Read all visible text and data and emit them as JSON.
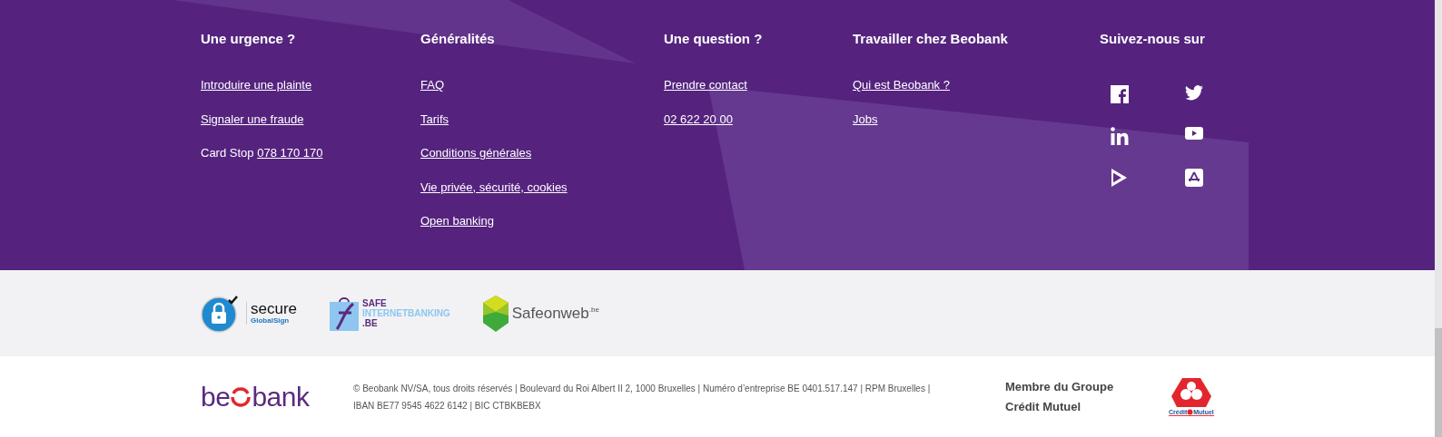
{
  "footer_columns": [
    {
      "heading": "Une urgence ?",
      "links": [
        {
          "kind": "link",
          "text": "Introduire une plainte"
        },
        {
          "kind": "link",
          "text": "Signaler une fraude"
        },
        {
          "kind": "labelled",
          "label": "Card Stop",
          "text": "078 170 170"
        }
      ]
    },
    {
      "heading": "Généralités",
      "links": [
        {
          "kind": "link",
          "text": "FAQ"
        },
        {
          "kind": "link",
          "text": "Tarifs"
        },
        {
          "kind": "link",
          "text": "Conditions générales"
        },
        {
          "kind": "link",
          "text": "Vie privée, sécurité, cookies"
        },
        {
          "kind": "link",
          "text": "Open banking"
        }
      ]
    },
    {
      "heading": "Une question ?",
      "links": [
        {
          "kind": "link",
          "text": "Prendre contact"
        },
        {
          "kind": "link",
          "text": "02 622 20 00"
        }
      ]
    },
    {
      "heading": "Travailler chez Beobank",
      "links": [
        {
          "kind": "link",
          "text": "Qui est Beobank ?"
        },
        {
          "kind": "link",
          "text": "Jobs"
        }
      ]
    }
  ],
  "social": {
    "heading": "Suivez-nous sur",
    "icons": [
      {
        "kind": "facebook"
      },
      {
        "kind": "twitter"
      },
      {
        "kind": "linkedin"
      },
      {
        "kind": "youtube"
      },
      {
        "kind": "play"
      },
      {
        "kind": "appstore"
      }
    ]
  },
  "badges": [
    {
      "kind": "globalsign",
      "title": "secure",
      "subtitle": "GlobalSign"
    },
    {
      "kind": "safebanking",
      "lines": [
        "SAFE",
        "INTERNETBANKING",
        ".BE"
      ]
    },
    {
      "kind": "safeonweb",
      "title": "Safeonweb",
      "suffix": ".be"
    }
  ],
  "bottom": {
    "logo": {
      "before": "be",
      "after": "bank"
    },
    "legal": [
      "© Beobank NV/SA, tous droits réservés | Boulevard du Roi Albert II 2, 1000 Bruxelles | Numéro d’entreprise BE 0401.517.147 | RPM Bruxelles |",
      "IBAN BE77 9545 4622 6142 | BIC CTBKBEBX"
    ],
    "group": [
      "Membre du Groupe",
      "Crédit Mutuel"
    ],
    "group_logo": {
      "left": "Crédit",
      "right": "Mutuel"
    }
  }
}
